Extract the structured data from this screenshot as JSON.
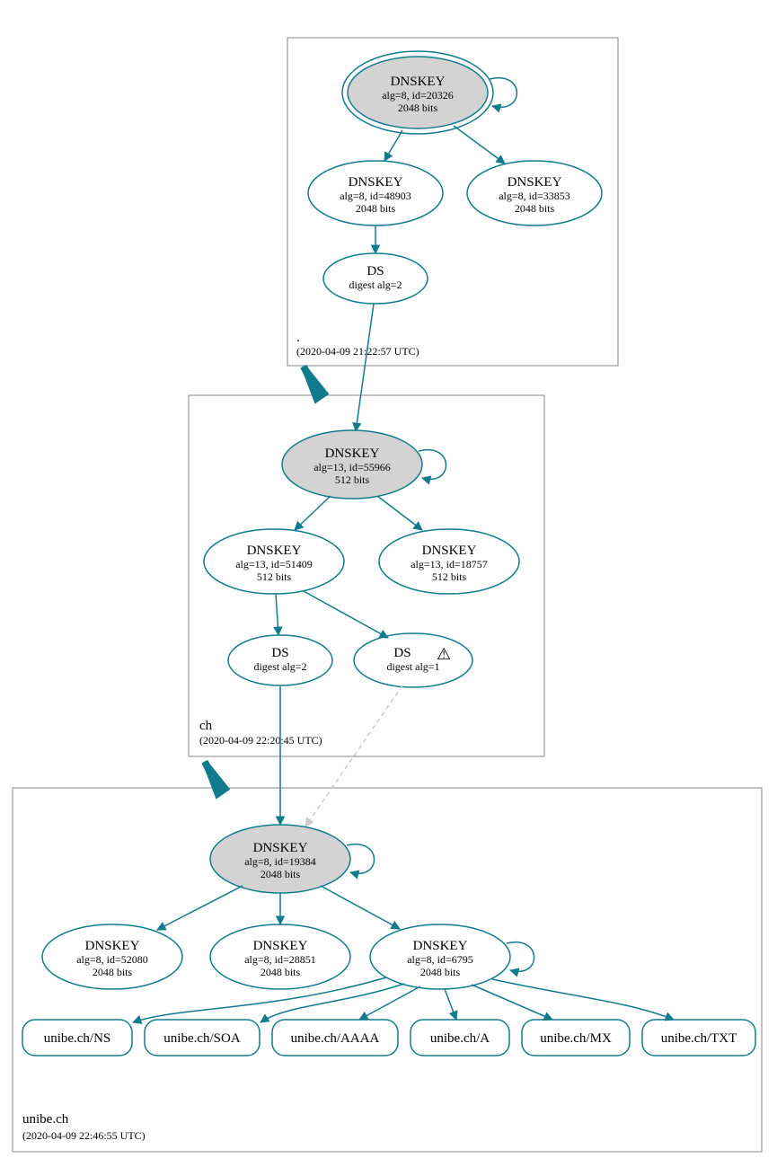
{
  "zones": {
    "root": {
      "label": ".",
      "timestamp": "(2020-04-09 21:22:57 UTC)",
      "nodes": {
        "ksk": {
          "title": "DNSKEY",
          "line2": "alg=8, id=20326",
          "line3": "2048 bits"
        },
        "zsk1": {
          "title": "DNSKEY",
          "line2": "alg=8, id=48903",
          "line3": "2048 bits"
        },
        "zsk2": {
          "title": "DNSKEY",
          "line2": "alg=8, id=33853",
          "line3": "2048 bits"
        },
        "ds": {
          "title": "DS",
          "line2": "digest alg=2"
        }
      }
    },
    "ch": {
      "label": "ch",
      "timestamp": "(2020-04-09 22:20:45 UTC)",
      "nodes": {
        "ksk": {
          "title": "DNSKEY",
          "line2": "alg=13, id=55966",
          "line3": "512 bits"
        },
        "zsk1": {
          "title": "DNSKEY",
          "line2": "alg=13, id=51409",
          "line3": "512 bits"
        },
        "zsk2": {
          "title": "DNSKEY",
          "line2": "alg=13, id=18757",
          "line3": "512 bits"
        },
        "ds1": {
          "title": "DS",
          "line2": "digest alg=2"
        },
        "ds2": {
          "title": "DS",
          "line2": "digest alg=1"
        }
      }
    },
    "unibe": {
      "label": "unibe.ch",
      "timestamp": "(2020-04-09 22:46:55 UTC)",
      "nodes": {
        "ksk": {
          "title": "DNSKEY",
          "line2": "alg=8, id=19384",
          "line3": "2048 bits"
        },
        "zsk1": {
          "title": "DNSKEY",
          "line2": "alg=8, id=52080",
          "line3": "2048 bits"
        },
        "zsk2": {
          "title": "DNSKEY",
          "line2": "alg=8, id=28851",
          "line3": "2048 bits"
        },
        "zsk3": {
          "title": "DNSKEY",
          "line2": "alg=8, id=6795",
          "line3": "2048 bits"
        }
      },
      "rr": {
        "ns": "unibe.ch/NS",
        "soa": "unibe.ch/SOA",
        "aaaa": "unibe.ch/AAAA",
        "a": "unibe.ch/A",
        "mx": "unibe.ch/MX",
        "txt": "unibe.ch/TXT"
      }
    }
  },
  "warning_icon": "⚠"
}
